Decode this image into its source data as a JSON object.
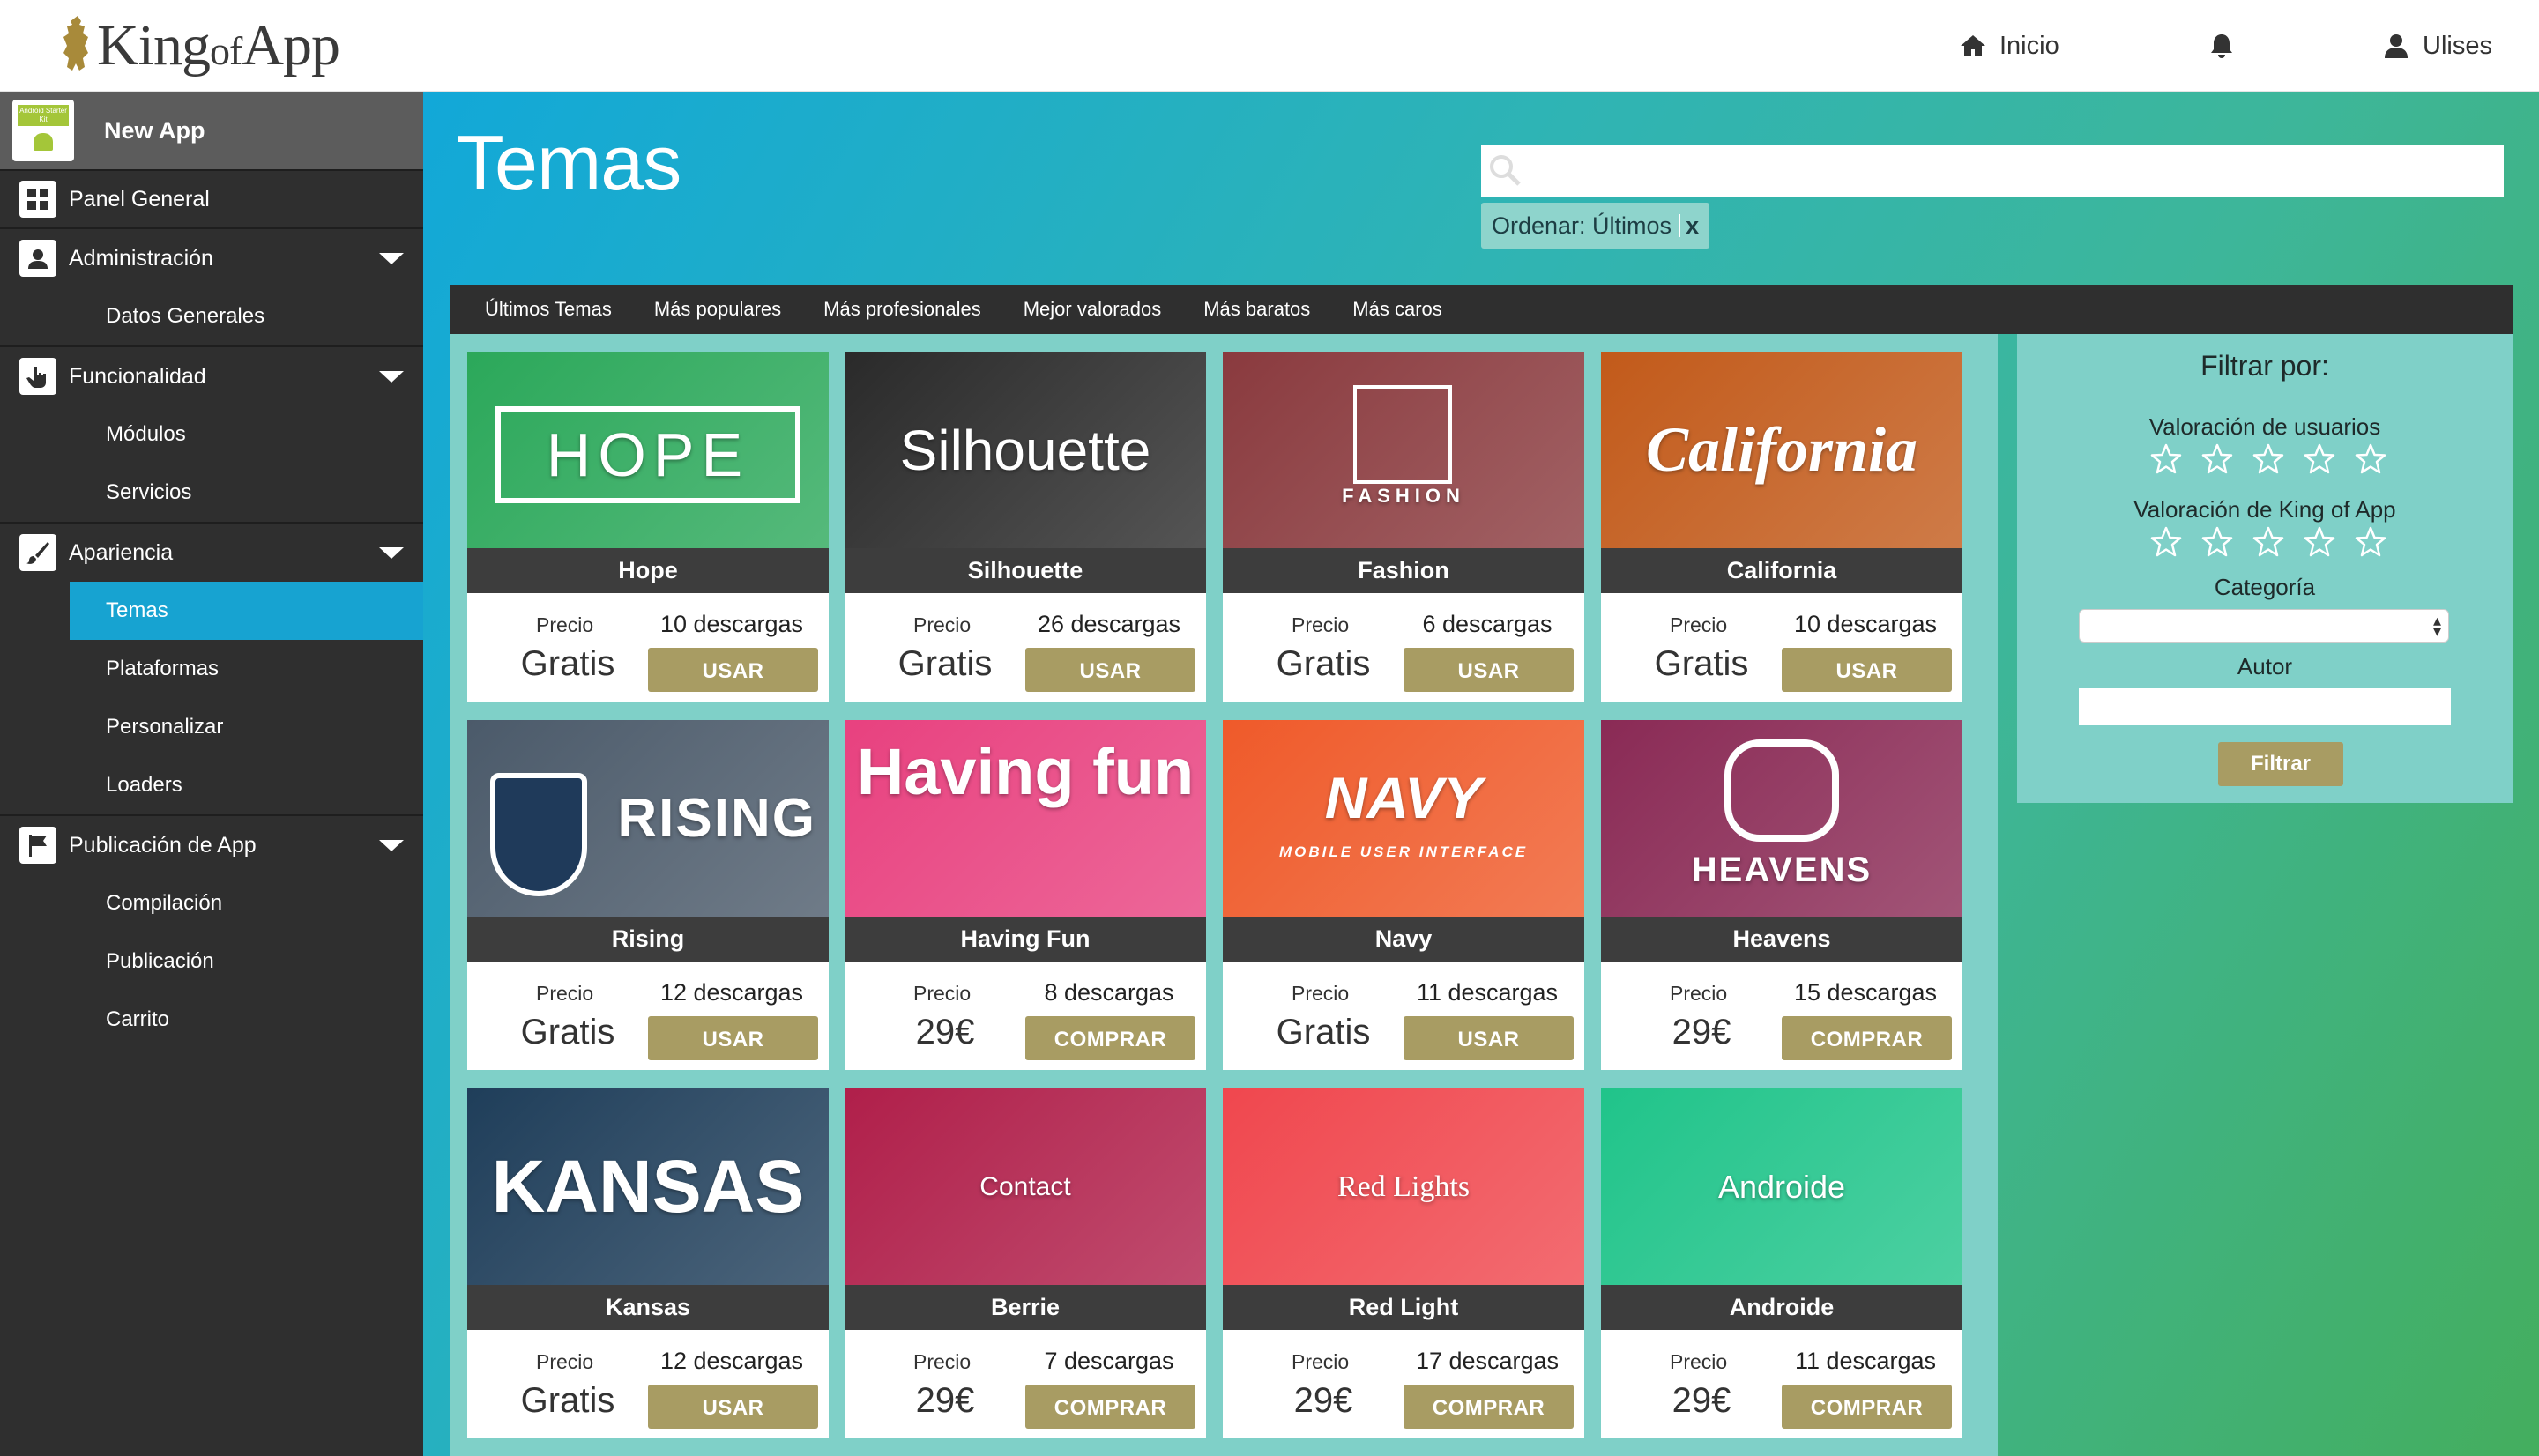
{
  "header": {
    "logo_text_1": "King",
    "logo_text_2": "of",
    "logo_text_3": "App",
    "nav_home": "Inicio",
    "nav_user": "Ulises"
  },
  "sidebar": {
    "app_badge": "Android Starter Kit",
    "app_name": "New App",
    "items": [
      {
        "label": "Panel General"
      },
      {
        "label": "Administración",
        "children": [
          "Datos Generales"
        ]
      },
      {
        "label": "Funcionalidad",
        "children": [
          "Módulos",
          "Servicios"
        ]
      },
      {
        "label": "Apariencia",
        "children": [
          "Temas",
          "Plataformas",
          "Personalizar",
          "Loaders"
        ]
      },
      {
        "label": "Publicación de App",
        "children": [
          "Compilación",
          "Publicación",
          "Carrito"
        ]
      }
    ]
  },
  "main": {
    "title": "Temas",
    "search_value": "",
    "order_label": "Ordenar: Últimos",
    "order_remove": "x",
    "tabs": [
      "Últimos Temas",
      "Más populares",
      "Más profesionales",
      "Mejor valorados",
      "Más baratos",
      "Más caros"
    ],
    "price_label": "Precio",
    "themes": [
      {
        "name": "Hope",
        "price": "Gratis",
        "downloads": "10 descargas",
        "action": "USAR",
        "thumb_text": "HOPE",
        "color": "#2ba85a"
      },
      {
        "name": "Silhouette",
        "price": "Gratis",
        "downloads": "26 descargas",
        "action": "USAR",
        "thumb_text": "Silhouette",
        "color": "#2a2a2a"
      },
      {
        "name": "Fashion",
        "price": "Gratis",
        "downloads": "6 descargas",
        "action": "USAR",
        "thumb_text": "FASHION",
        "color": "#8a3a3e"
      },
      {
        "name": "California",
        "price": "Gratis",
        "downloads": "10 descargas",
        "action": "USAR",
        "thumb_text": "California",
        "color": "#c25a1a"
      },
      {
        "name": "Rising",
        "price": "Gratis",
        "downloads": "12 descargas",
        "action": "USAR",
        "thumb_text": "RISING",
        "color": "#4b5a6a"
      },
      {
        "name": "Having Fun",
        "price": "29€",
        "downloads": "8 descargas",
        "action": "COMPRAR",
        "thumb_text": "Having fun",
        "color": "#e8417f"
      },
      {
        "name": "Navy",
        "price": "Gratis",
        "downloads": "11 descargas",
        "action": "USAR",
        "thumb_text": "NAVY",
        "thumb_sub": "MOBILE USER INTERFACE",
        "color": "#ef5a2a"
      },
      {
        "name": "Heavens",
        "price": "29€",
        "downloads": "15 descargas",
        "action": "COMPRAR",
        "thumb_text": "HEAVENS",
        "color": "#8a2a55"
      },
      {
        "name": "Kansas",
        "price": "Gratis",
        "downloads": "12 descargas",
        "action": "USAR",
        "thumb_text": "KANSAS",
        "color": "#1f3e5a"
      },
      {
        "name": "Berrie",
        "price": "29€",
        "downloads": "7 descargas",
        "action": "COMPRAR",
        "thumb_text": "Contact",
        "color": "#b01f4a"
      },
      {
        "name": "Red Light",
        "price": "29€",
        "downloads": "17 descargas",
        "action": "COMPRAR",
        "thumb_text": "Red Lights",
        "color": "#f0474e"
      },
      {
        "name": "Androide",
        "price": "29€",
        "downloads": "11 descargas",
        "action": "COMPRAR",
        "thumb_text": "Androide",
        "color": "#20c48a"
      }
    ]
  },
  "filter": {
    "title": "Filtrar por:",
    "users_rating": "Valoración de usuarios",
    "kingofapp_rating": "Valoración de King of App",
    "category": "Categoría",
    "author": "Autor",
    "button": "Filtrar",
    "stars": 5
  },
  "colors": {
    "accent_blue": "#17a3d1",
    "button_gold": "#a89c63",
    "sidebar_bg": "#2f2f2f"
  }
}
